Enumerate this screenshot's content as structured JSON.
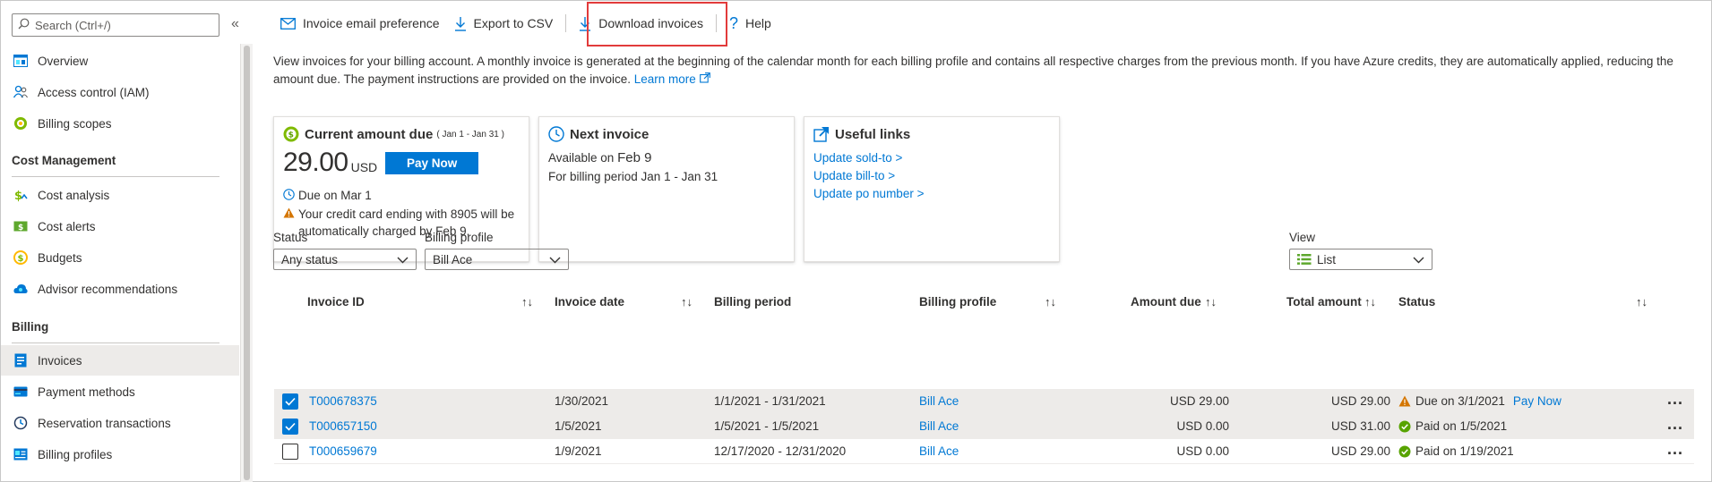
{
  "sidebar": {
    "search_placeholder": "Search (Ctrl+/)",
    "items_top": [
      {
        "label": "Overview"
      },
      {
        "label": "Access control (IAM)"
      },
      {
        "label": "Billing scopes"
      }
    ],
    "cost_management_title": "Cost Management",
    "cost_items": [
      {
        "label": "Cost analysis"
      },
      {
        "label": "Cost alerts"
      },
      {
        "label": "Budgets"
      },
      {
        "label": "Advisor recommendations"
      }
    ],
    "billing_title": "Billing",
    "billing_items": [
      {
        "label": "Invoices"
      },
      {
        "label": "Payment methods"
      },
      {
        "label": "Reservation transactions"
      },
      {
        "label": "Billing profiles"
      }
    ]
  },
  "toolbar": {
    "email_pref": "Invoice email preference",
    "export_csv": "Export to CSV",
    "download": "Download invoices",
    "help": "Help"
  },
  "intro": {
    "text": "View invoices for your billing account. A monthly invoice is generated at the beginning of the calendar month for each billing profile and contains all respective charges from the previous month. If you have Azure credits, they are automatically applied, reducing the amount due. The payment instructions are provided on the invoice.",
    "learn_more": "Learn more"
  },
  "cards": {
    "current": {
      "title": "Current amount due",
      "range": "( Jan 1 - Jan 31 )",
      "amount": "29.00",
      "currency": "USD",
      "pay_now": "Pay Now",
      "due": "Due on Mar 1",
      "warning": "Your credit card ending with 8905 will be automatically charged by Feb 9."
    },
    "next": {
      "title": "Next invoice",
      "available_prefix": "Available on",
      "available_date": "Feb 9",
      "period": "For billing period Jan 1 - Jan 31"
    },
    "links": {
      "title": "Useful links",
      "items": [
        "Update sold-to >",
        "Update bill-to >",
        "Update po number >"
      ]
    }
  },
  "filters": {
    "status_label": "Status",
    "status_value": "Any status",
    "profile_label": "Billing profile",
    "profile_value": "Bill Ace",
    "view_label": "View",
    "view_value": "List"
  },
  "table": {
    "headers": {
      "invoice_id": "Invoice ID",
      "invoice_date": "Invoice date",
      "billing_period": "Billing period",
      "billing_profile": "Billing profile",
      "amount_due": "Amount due",
      "total_amount": "Total amount",
      "status": "Status"
    },
    "rows": [
      {
        "id": "T000678375",
        "date": "1/30/2021",
        "period": "1/1/2021 - 1/31/2021",
        "profile": "Bill Ace",
        "due": "USD 29.00",
        "total": "USD 29.00",
        "status": "Due on 3/1/2021",
        "status_kind": "warning",
        "action": "Pay Now",
        "selected": true
      },
      {
        "id": "T000657150",
        "date": "1/5/2021",
        "period": "1/5/2021 - 1/5/2021",
        "profile": "Bill Ace",
        "due": "USD 0.00",
        "total": "USD 31.00",
        "status": "Paid on 1/5/2021",
        "status_kind": "paid",
        "action": "",
        "selected": true
      },
      {
        "id": "T000659679",
        "date": "1/9/2021",
        "period": "12/17/2020 - 12/31/2020",
        "profile": "Bill Ace",
        "due": "USD 0.00",
        "total": "USD 29.00",
        "status": "Paid on 1/19/2021",
        "status_kind": "paid",
        "action": "",
        "selected": false
      }
    ],
    "more": "..."
  }
}
